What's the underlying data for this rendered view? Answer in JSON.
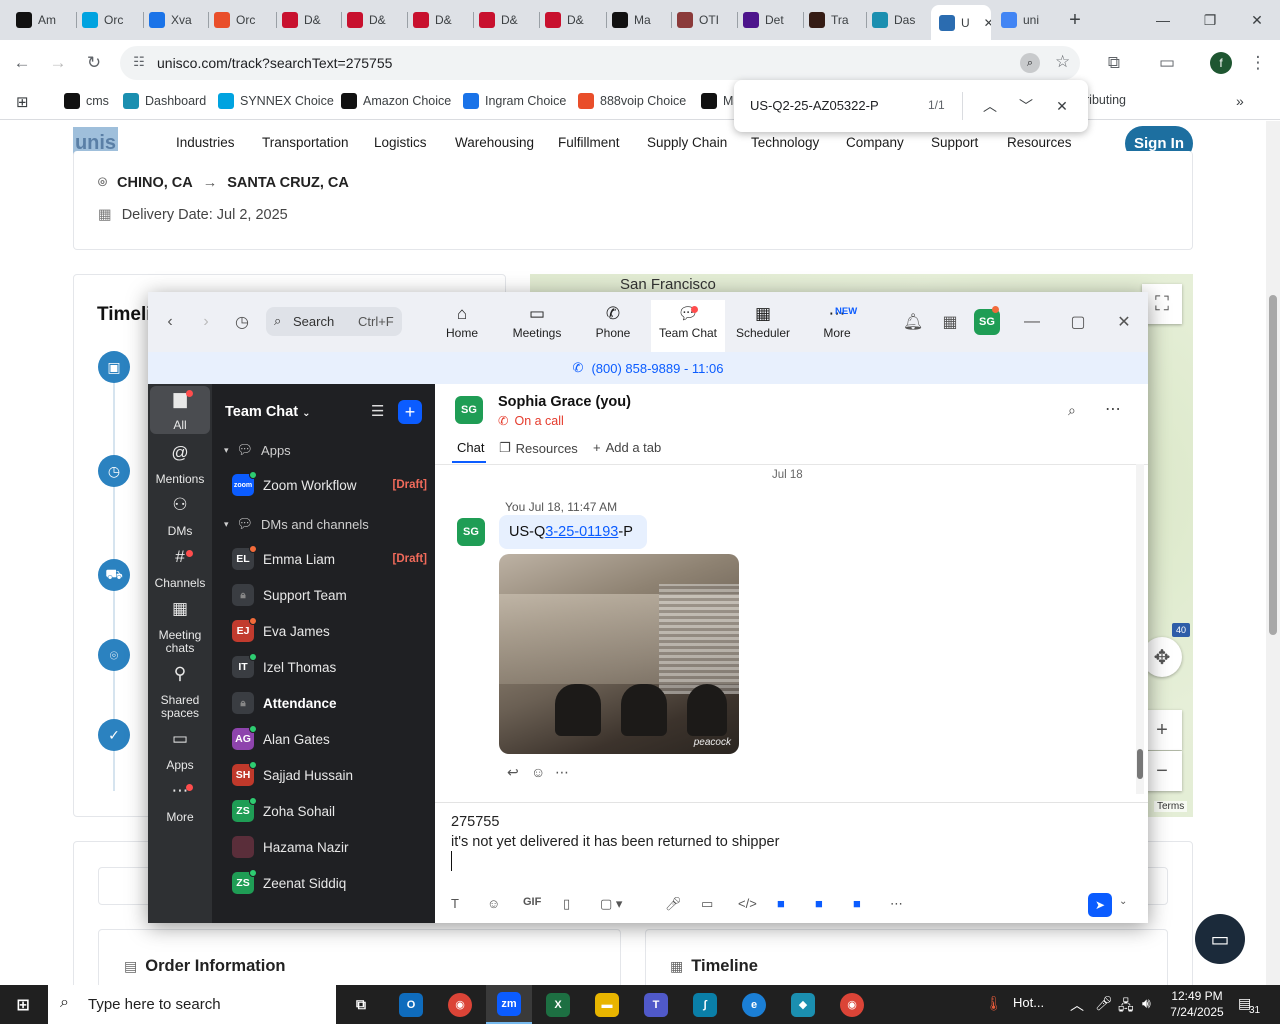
{
  "browser": {
    "tabs": [
      {
        "label": "Am",
        "icon": "amazon-icon",
        "color": "#111111"
      },
      {
        "label": "Orc",
        "icon": "synnex-icon",
        "color": "#00a3e0"
      },
      {
        "label": "Xva",
        "icon": "xva-icon",
        "color": "#1a73e8"
      },
      {
        "label": "Orc",
        "icon": "s-icon",
        "color": "#e94e2a"
      },
      {
        "label": "D&",
        "icon": "dh-icon",
        "color": "#c8102e"
      },
      {
        "label": "D&",
        "icon": "dh-icon",
        "color": "#c8102e"
      },
      {
        "label": "D&",
        "icon": "dh-icon",
        "color": "#c8102e"
      },
      {
        "label": "D&",
        "icon": "dh-icon",
        "color": "#c8102e"
      },
      {
        "label": "D&",
        "icon": "dh-icon",
        "color": "#c8102e"
      },
      {
        "label": "Ma",
        "icon": "amazon-icon",
        "color": "#111111"
      },
      {
        "label": "OTI",
        "icon": "oti-icon",
        "color": "#8b3a3a"
      },
      {
        "label": "Det",
        "icon": "fedex-icon",
        "color": "#4d148c"
      },
      {
        "label": "Tra",
        "icon": "ups-icon",
        "color": "#351c15"
      },
      {
        "label": "Das",
        "icon": "dash-icon",
        "color": "#1b8fb0"
      },
      {
        "label": "U",
        "icon": "unis-icon",
        "color": "#2b6cb0"
      },
      {
        "label": "uni",
        "icon": "google-icon",
        "color": "#4285f4"
      }
    ],
    "url": "unisco.com/track?searchText=275755",
    "bookmarks": [
      {
        "label": "cms",
        "icon": "cms-icon",
        "color": "#111111"
      },
      {
        "label": "Dashboard",
        "icon": "dashboard-icon",
        "color": "#1b8fb0"
      },
      {
        "label": "SYNNEX Choice",
        "icon": "synnex-icon",
        "color": "#00a3e0"
      },
      {
        "label": "Amazon Choice",
        "icon": "amazon-icon",
        "color": "#111111"
      },
      {
        "label": "Ingram Choice",
        "icon": "ingram-icon",
        "color": "#1a73e8"
      },
      {
        "label": "888voip Choice",
        "icon": "voip-icon",
        "color": "#e94e2a"
      },
      {
        "label": "Ma",
        "icon": "amazon-icon",
        "color": "#111111"
      },
      {
        "label": "ributing",
        "icon": "",
        "color": ""
      }
    ],
    "find": {
      "query": "US-Q2-25-AZ05322-P",
      "count": "1/1"
    }
  },
  "site": {
    "logo": "unis",
    "nav": [
      "Industries",
      "Transportation",
      "Logistics",
      "Warehousing",
      "Fulfillment",
      "Supply Chain",
      "Technology",
      "Company",
      "Support",
      "Resources"
    ],
    "signin": "Sign In",
    "origin": "CHINO, CA",
    "destination": "SANTA CRUZ, CA",
    "delivery_date": "Delivery Date: Jul 2, 2025",
    "timeline_title": "Timeli",
    "map_label": "San Francisco",
    "map_terms": "Terms",
    "map_road": "40",
    "order_info": "Order Information",
    "timeline_bottom": "Timeline"
  },
  "zoom": {
    "search": "Search",
    "search_shortcut": "Ctrl+F",
    "tabs": [
      "Home",
      "Meetings",
      "Phone",
      "Team Chat",
      "Scheduler",
      "More"
    ],
    "new_badge": "NEW",
    "avatar": "SG",
    "call_bar": "(800) 858-9889 - 11:06",
    "rail": [
      "All",
      "Mentions",
      "DMs",
      "Channels",
      "Meeting chats",
      "Shared spaces",
      "Apps",
      "More"
    ],
    "list": {
      "title": "Team Chat",
      "apps_section": "Apps",
      "dms_section": "DMs and channels",
      "items": [
        {
          "initials": "zoom",
          "name": "Zoom Workflow",
          "draft": "[Draft]",
          "color": "#0b5cff",
          "bold": false
        },
        {
          "initials": "EL",
          "name": "Emma Liam",
          "draft": "[Draft]",
          "color": "#3a3d42",
          "bold": false
        },
        {
          "initials": "",
          "name": "Support Team",
          "draft": "",
          "color": "#3a3d42",
          "bold": false
        },
        {
          "initials": "EJ",
          "name": "Eva James",
          "draft": "",
          "color": "#c23b2e",
          "bold": false
        },
        {
          "initials": "IT",
          "name": "Izel Thomas",
          "draft": "",
          "color": "#3a3d42",
          "bold": false
        },
        {
          "initials": "",
          "name": "Attendance",
          "draft": "",
          "color": "#3a3d42",
          "bold": true
        },
        {
          "initials": "AG",
          "name": "Alan Gates",
          "draft": "",
          "color": "#8e44ad",
          "bold": false
        },
        {
          "initials": "SH",
          "name": "Sajjad Hussain",
          "draft": "",
          "color": "#c0392b",
          "bold": false
        },
        {
          "initials": "ZS",
          "name": "Zoha Sohail",
          "draft": "",
          "color": "#1f9d55",
          "bold": false
        },
        {
          "initials": "",
          "name": "Hazama Nazir",
          "draft": "",
          "color": "#5a2e3a",
          "bold": false
        },
        {
          "initials": "ZS",
          "name": "Zeenat Siddiq",
          "draft": "",
          "color": "#1f9d55",
          "bold": false
        }
      ]
    },
    "chat": {
      "name": "Sophia Grace (you)",
      "status": "On a call",
      "tabs": [
        "Chat",
        "Resources",
        "Add a tab"
      ],
      "date": "Jul 18",
      "meta": "You Jul 18, 11:47 AM",
      "msg_prefix": "US-Q",
      "msg_link": "3-25-01193",
      "msg_suffix": "-P",
      "photo_watermark": "peacock",
      "compose_line1": "275755",
      "compose_line2": "it's not yet delivered it has been returned to shipper"
    }
  },
  "taskbar": {
    "search_placeholder": "Type here to search",
    "weather": "Hot...",
    "time": "12:49 PM",
    "date": "7/24/2025",
    "notifications": "31"
  }
}
